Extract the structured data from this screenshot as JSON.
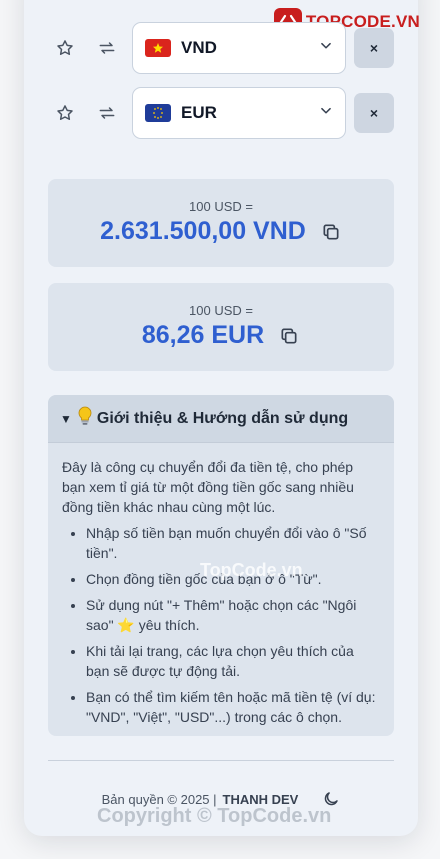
{
  "logo": {
    "text": "TOPCODE.VN"
  },
  "rows": [
    {
      "code": "VND",
      "flag": "vn"
    },
    {
      "code": "EUR",
      "flag": "eu"
    }
  ],
  "remove_label": "×",
  "results": [
    {
      "label": "100 USD =",
      "value": "2.631.500,00 VND"
    },
    {
      "label": "100 USD =",
      "value": "86,26 EUR"
    }
  ],
  "guide": {
    "arrow": "▼",
    "title": "Giới thiệu & Hướng dẫn sử dụng",
    "intro": "Đây là công cụ chuyển đổi đa tiền tệ, cho phép bạn xem tỉ giá từ một đồng tiền gốc sang nhiều đồng tiền khác nhau cùng một lúc.",
    "items": [
      "Nhập số tiền bạn muốn chuyển đổi vào ô \"Số tiền\".",
      "Chọn đồng tiền gốc của bạn ở ô \"Từ\".",
      "Sử dụng nút \"+ Thêm\" hoặc chọn các \"Ngôi sao\" ⭐ yêu thích.",
      "Khi tải lại trang, các lựa chọn yêu thích của bạn sẽ được tự động tải.",
      "Bạn có thể tìm kiếm tên hoặc mã tiền tệ (ví dụ: \"VND\", \"Việt\", \"USD\"...) trong các ô chọn."
    ]
  },
  "footer": {
    "copyright": "Bản quyền © 2025 |",
    "author": "THANH DEV"
  },
  "watermarks": {
    "center": "TopCode.vn",
    "bottom": "Copyright © TopCode.vn"
  },
  "colors": {
    "accent": "#2f5fd0",
    "brand": "#c81e1e"
  }
}
